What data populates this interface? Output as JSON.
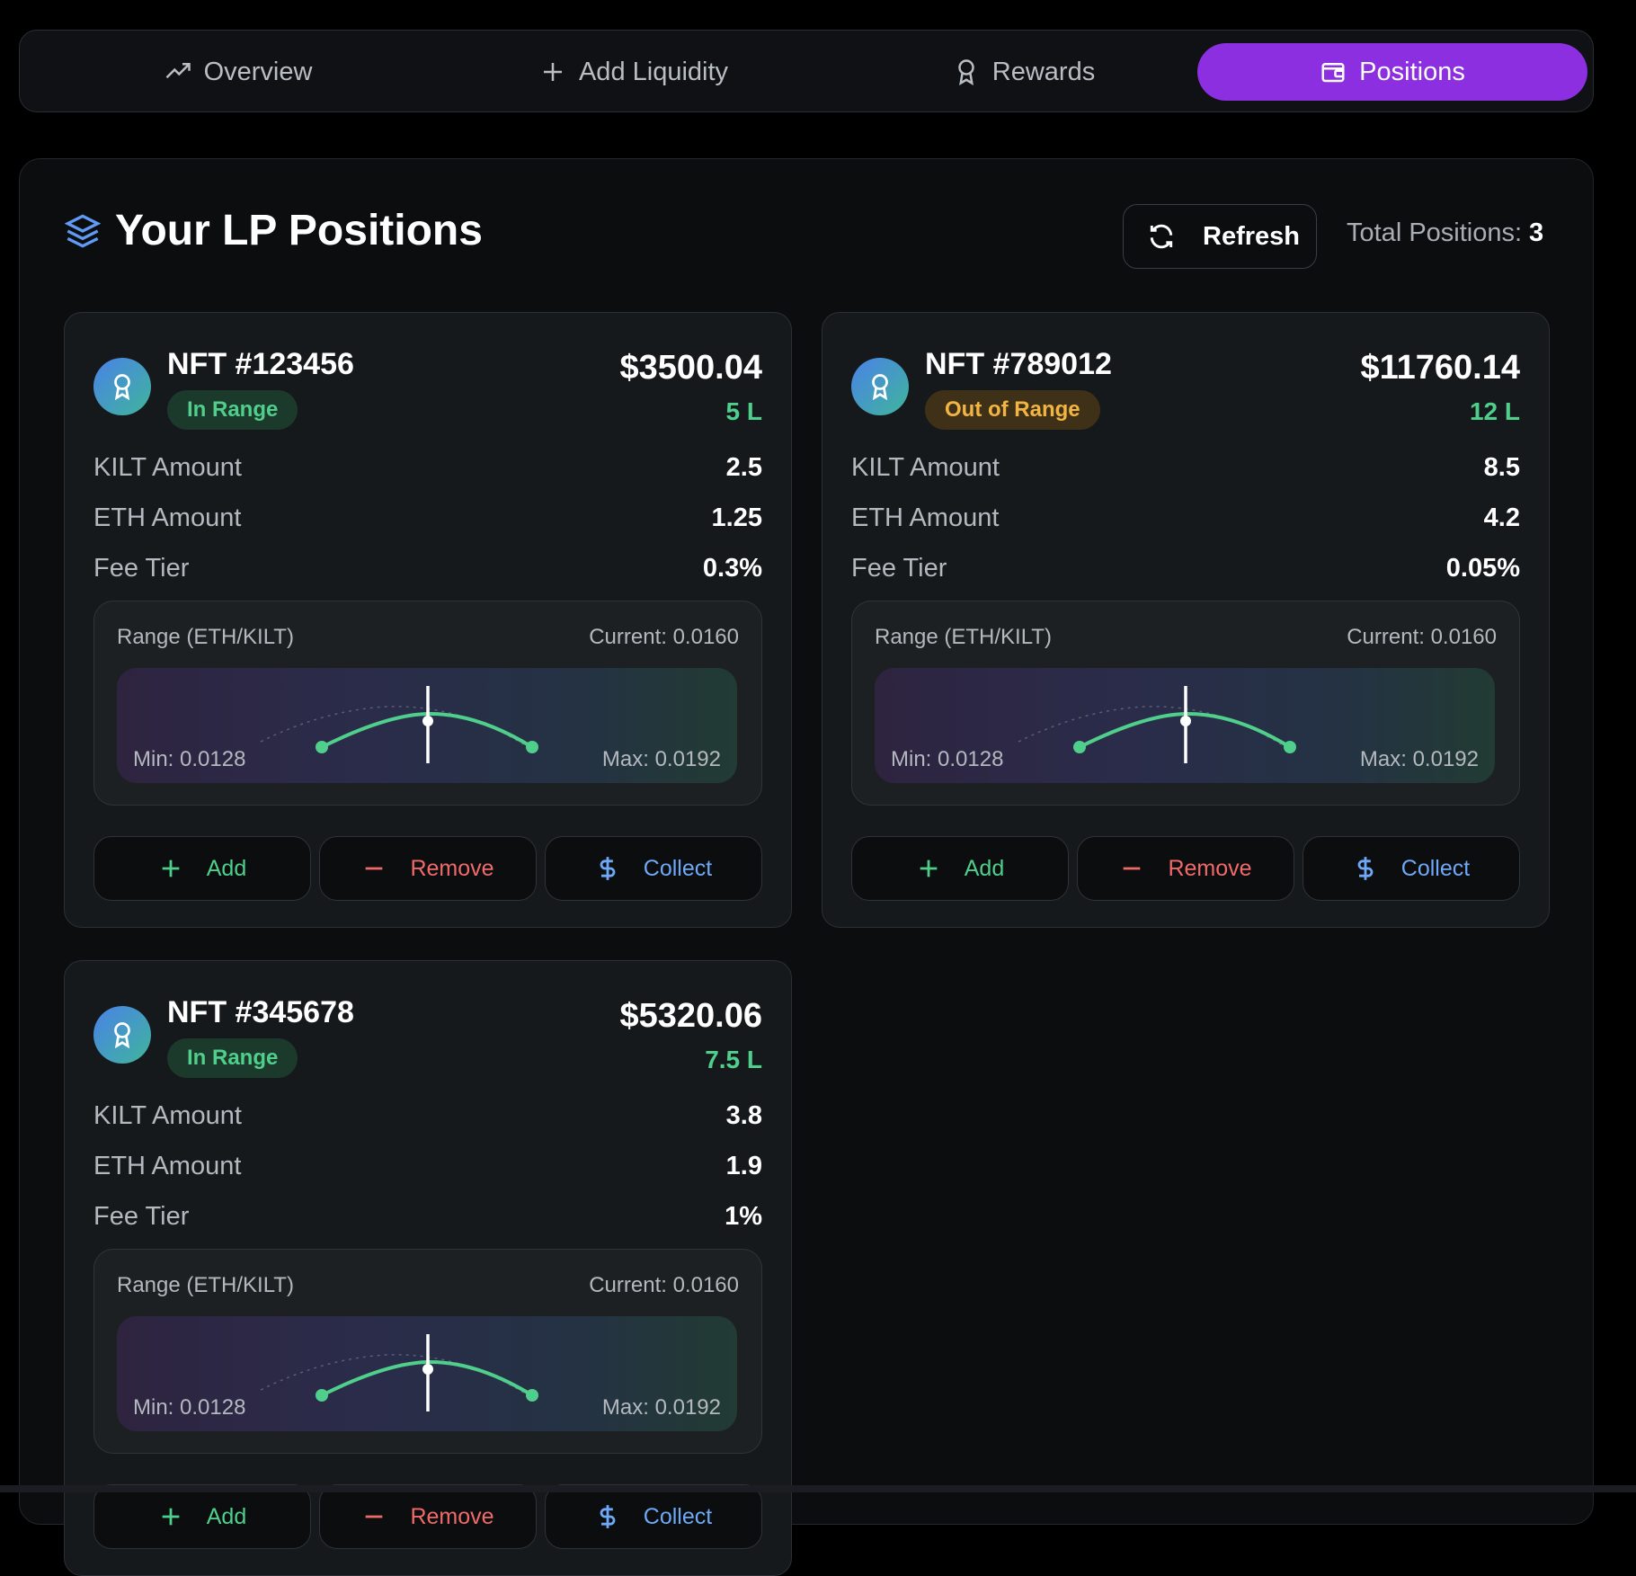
{
  "tabs": [
    {
      "label": "Overview",
      "icon": "trending-up-icon",
      "active": false
    },
    {
      "label": "Add Liquidity",
      "icon": "plus-icon",
      "active": false
    },
    {
      "label": "Rewards",
      "icon": "award-icon",
      "active": false
    },
    {
      "label": "Positions",
      "icon": "wallet-icon",
      "active": true
    }
  ],
  "header": {
    "title": "Your LP Positions",
    "icon": "layers-icon",
    "refresh_label": "Refresh",
    "total_label": "Total Positions:",
    "total_value": "3"
  },
  "positions": [
    {
      "nft_id": "NFT #123456",
      "status": "In Range",
      "status_type": "in-range",
      "value": "$3500.04",
      "liquidity": "5 L",
      "kilt_label": "KILT Amount",
      "kilt_value": "2.5",
      "eth_label": "ETH Amount",
      "eth_value": "1.25",
      "fee_label": "Fee Tier",
      "fee_value": "0.3%",
      "range_label": "Range (ETH/KILT)",
      "current": "Current: 0.0160",
      "min": "Min: 0.0128",
      "max": "Max: 0.0192",
      "add_label": "Add",
      "remove_label": "Remove",
      "collect_label": "Collect"
    },
    {
      "nft_id": "NFT #789012",
      "status": "Out of Range",
      "status_type": "out-of-range",
      "value": "$11760.14",
      "liquidity": "12 L",
      "kilt_label": "KILT Amount",
      "kilt_value": "8.5",
      "eth_label": "ETH Amount",
      "eth_value": "4.2",
      "fee_label": "Fee Tier",
      "fee_value": "0.05%",
      "range_label": "Range (ETH/KILT)",
      "current": "Current: 0.0160",
      "min": "Min: 0.0128",
      "max": "Max: 0.0192",
      "add_label": "Add",
      "remove_label": "Remove",
      "collect_label": "Collect"
    },
    {
      "nft_id": "NFT #345678",
      "status": "In Range",
      "status_type": "in-range",
      "value": "$5320.06",
      "liquidity": "7.5 L",
      "kilt_label": "KILT Amount",
      "kilt_value": "3.8",
      "eth_label": "ETH Amount",
      "eth_value": "1.9",
      "fee_label": "Fee Tier",
      "fee_value": "1%",
      "range_label": "Range (ETH/KILT)",
      "current": "Current: 0.0160",
      "min": "Min: 0.0128",
      "max": "Max: 0.0192",
      "add_label": "Add",
      "remove_label": "Remove",
      "collect_label": "Collect"
    }
  ],
  "colors": {
    "accent": "#8b2fe0",
    "in_range": "#4fcf8b",
    "out_of_range": "#f2b443",
    "remove": "#f06a6a",
    "collect": "#6ea8f7"
  }
}
